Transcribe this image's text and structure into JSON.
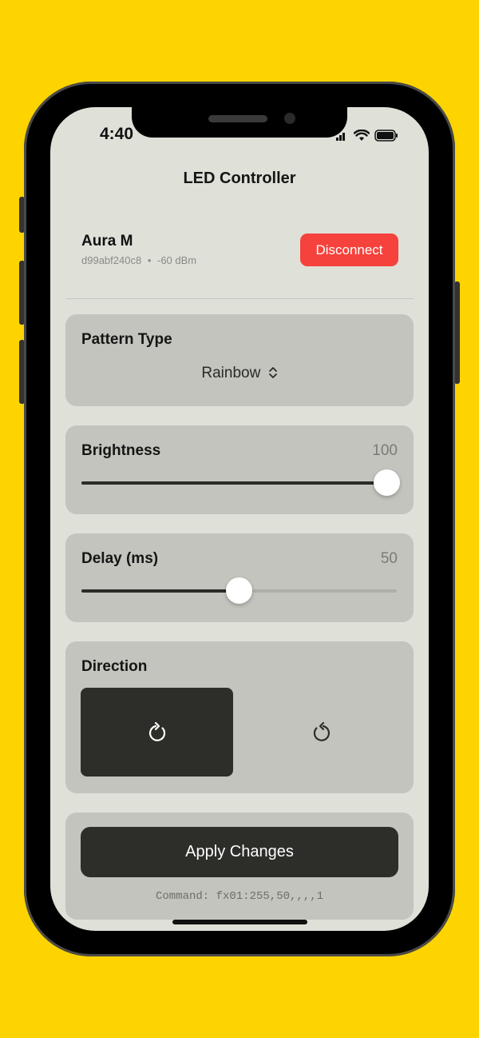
{
  "status_bar": {
    "time": "4:40"
  },
  "header": {
    "title": "LED Controller"
  },
  "device": {
    "name": "Aura M",
    "id": "d99abf240c8",
    "separator": "•",
    "signal": "-60 dBm",
    "disconnect_label": "Disconnect"
  },
  "pattern": {
    "label": "Pattern Type",
    "selected": "Rainbow"
  },
  "brightness": {
    "label": "Brightness",
    "value": 100,
    "value_text": "100",
    "min": 0,
    "max": 100
  },
  "delay": {
    "label": "Delay (ms)",
    "value": 50,
    "value_text": "50",
    "min": 0,
    "max": 100
  },
  "direction": {
    "label": "Direction",
    "options": [
      "clockwise-icon",
      "counterclockwise-icon"
    ],
    "selected": 0
  },
  "apply": {
    "label": "Apply Changes",
    "command": "Command: fx01:255,50,,,,1"
  },
  "colors": {
    "background": "#FDD400",
    "accent_red": "#F6423C",
    "dark": "#2d2d2a",
    "card": "#C3C4BD"
  }
}
